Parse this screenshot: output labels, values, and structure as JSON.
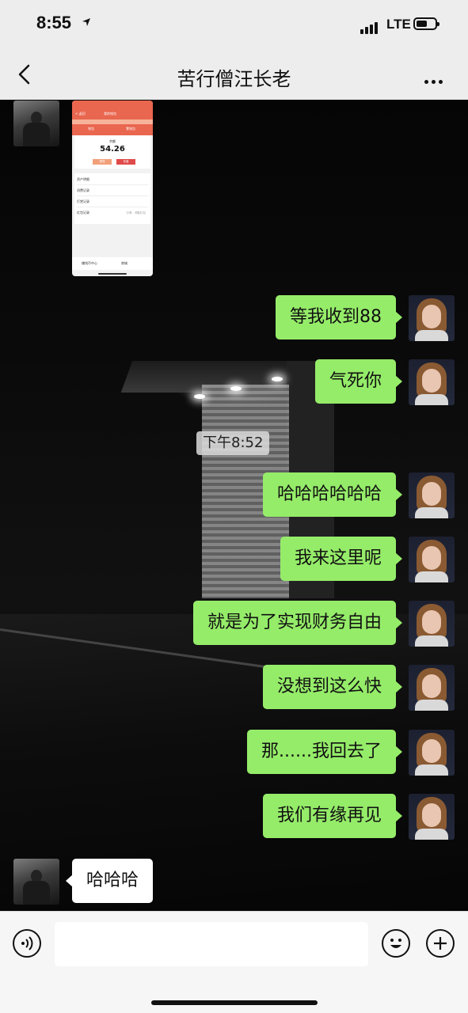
{
  "status_bar": {
    "time": "8:55",
    "network": "LTE"
  },
  "header": {
    "title": "苦行僧汪长老"
  },
  "chat": {
    "timestamp": "下午8:52",
    "screenshot": {
      "nav_back": "< 返回",
      "nav_title": "我的钱包",
      "tab_1": "钱包",
      "tab_2": "零钱包",
      "balance_label": "余额",
      "balance_value": "54.26",
      "btn_1": "提现",
      "btn_2": "充值",
      "rows": [
        "资产明细",
        "消费记录",
        "打赏记录",
        "红包记录"
      ],
      "row_note": "分享、领取红包",
      "bottom_1": "赚钱币中心",
      "bottom_2": "商城"
    },
    "messages": [
      {
        "side": "me",
        "text": "等我收到88"
      },
      {
        "side": "me",
        "text": "气死你"
      },
      {
        "side": "me",
        "text": "哈哈哈哈哈哈"
      },
      {
        "side": "me",
        "text": "我来这里呢"
      },
      {
        "side": "me",
        "text": "就是为了实现财务自由"
      },
      {
        "side": "me",
        "text": "没想到这么快"
      },
      {
        "side": "me",
        "text": "那......我回去了"
      },
      {
        "side": "me",
        "text": "我们有缘再见"
      },
      {
        "side": "them",
        "text": "哈哈哈"
      }
    ]
  },
  "input_bar": {
    "voice_icon": "voice-icon",
    "emoji_icon": "emoji-icon",
    "plus_icon": "plus-icon"
  }
}
